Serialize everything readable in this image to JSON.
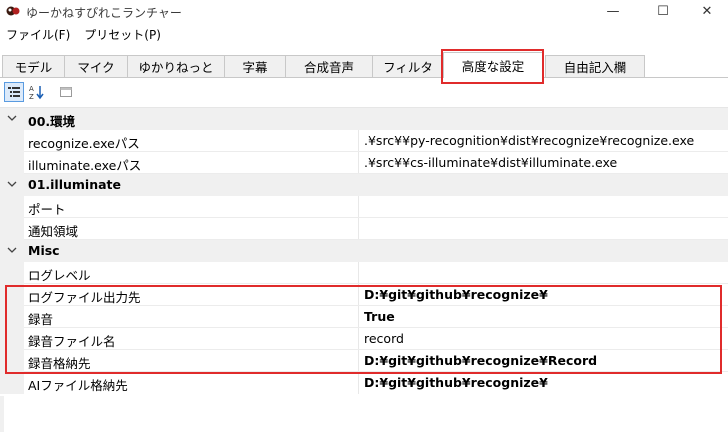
{
  "window": {
    "title": "ゆーかねすぴれこランチャー",
    "minimize_glyph": "—",
    "maximize_glyph": "☐",
    "close_glyph": "✕"
  },
  "menu": [
    {
      "label": "ファイル(F)"
    },
    {
      "label": "プリセット(P)"
    }
  ],
  "tabs": [
    {
      "label": "モデル",
      "active": false
    },
    {
      "label": "マイク",
      "active": false
    },
    {
      "label": "ゆかりねっと",
      "active": false
    },
    {
      "label": "字幕",
      "active": false
    },
    {
      "label": "合成音声",
      "active": false
    },
    {
      "label": "フィルタ",
      "active": false
    },
    {
      "label": "高度な設定",
      "active": true
    },
    {
      "label": "自由記入欄",
      "active": false
    }
  ],
  "toolbar": {
    "buttons": [
      {
        "icon": "categorized-view-icon",
        "pressed": true
      },
      {
        "icon": "sort-alphabetical-icon",
        "pressed": false
      },
      {
        "icon": "property-pages-icon",
        "pressed": false
      }
    ],
    "az_glyph": "A↓Z"
  },
  "grid": {
    "categories": [
      {
        "label": "00.環境",
        "props": [
          {
            "name": "recognize.exeパス",
            "value": ".¥src¥¥py-recognition¥dist¥recognize¥recognize.exe",
            "bold": false
          },
          {
            "name": "illuminate.exeパス",
            "value": ".¥src¥¥cs-illuminate¥dist¥illuminate.exe",
            "bold": false
          }
        ]
      },
      {
        "label": "01.illuminate",
        "props": [
          {
            "name": "ポート",
            "value": "",
            "bold": false
          },
          {
            "name": "通知領域",
            "value": "",
            "bold": false
          }
        ]
      },
      {
        "label": "Misc",
        "props": [
          {
            "name": "ログレベル",
            "value": "",
            "bold": false
          },
          {
            "name": "ログファイル出力先",
            "value": "D:¥git¥github¥recognize¥",
            "bold": true
          },
          {
            "name": "録音",
            "value": "True",
            "bold": true
          },
          {
            "name": "録音ファイル名",
            "value": "record",
            "bold": false
          },
          {
            "name": "録音格納先",
            "value": "D:¥git¥github¥recognize¥Record",
            "bold": true
          },
          {
            "name": "AIファイル格納先",
            "value": "D:¥git¥github¥recognize¥",
            "bold": true
          }
        ]
      }
    ]
  },
  "colors": {
    "highlight": "#e02b2b",
    "category_bg": "#f0f0f0"
  }
}
